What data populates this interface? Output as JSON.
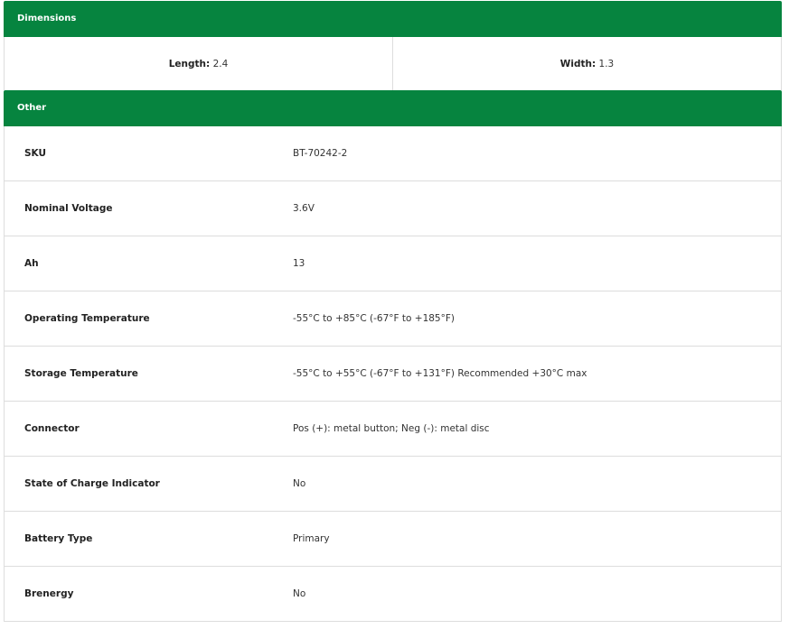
{
  "dimensions": {
    "title": "Dimensions",
    "length_label": "Length:",
    "length": "2.4",
    "width_label": "Width:",
    "width": "1.3"
  },
  "other": {
    "title": "Other",
    "rows": [
      {
        "label": "SKU",
        "value": "BT-70242-2"
      },
      {
        "label": "Nominal Voltage",
        "value": "3.6V"
      },
      {
        "label": "Ah",
        "value": "13"
      },
      {
        "label": "Operating Temperature",
        "value": "-55°C to +85°C (-67°F to +185°F)"
      },
      {
        "label": "Storage Temperature",
        "value": "-55°C to +55°C (-67°F to +131°F) Recommended +30°C max"
      },
      {
        "label": "Connector",
        "value": "Pos (+): metal button; Neg (-): metal disc"
      },
      {
        "label": "State of Charge Indicator",
        "value": "No"
      },
      {
        "label": "Battery Type",
        "value": "Primary"
      },
      {
        "label": "Brenergy",
        "value": "No"
      }
    ]
  }
}
